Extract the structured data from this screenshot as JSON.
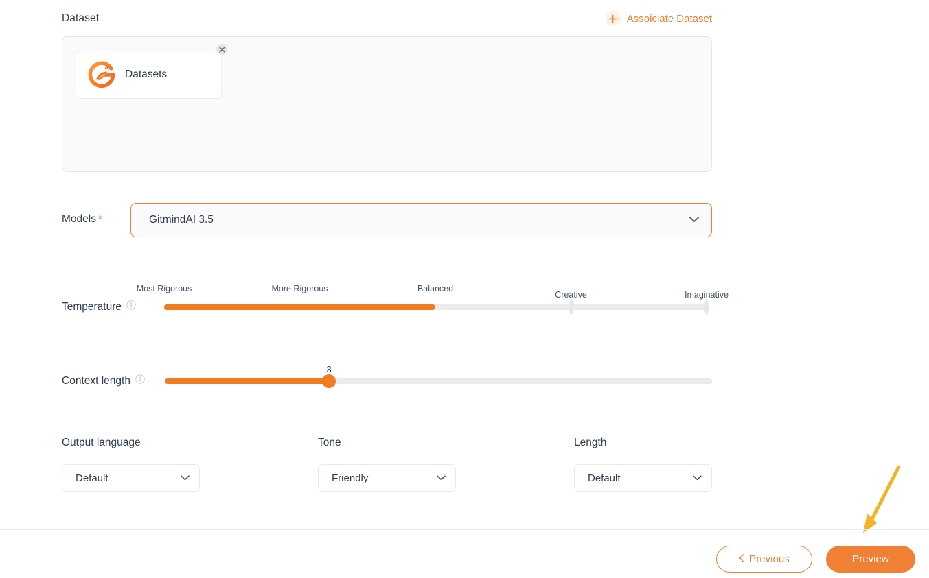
{
  "dataset": {
    "section_label": "Dataset",
    "associate_label": "Assoiciate Dataset",
    "associate_icon": "plus-icon",
    "card": {
      "name": "Datasets",
      "logo_icon": "gitmind-dataset-logo",
      "close_icon": "close-icon"
    }
  },
  "models": {
    "label": "Models",
    "required_mark": "*",
    "value": "GitmindAI 3.5",
    "chevron_icon": "chevron-down-icon"
  },
  "temperature": {
    "label": "Temperature",
    "info_icon": "info-icon",
    "stops": [
      {
        "label": "Most Rigorous",
        "active": true
      },
      {
        "label": "More Rigorous",
        "active": true
      },
      {
        "label": "Balanced",
        "active": true
      },
      {
        "label": "Creative",
        "active": false
      },
      {
        "label": "Imaginative",
        "active": false
      }
    ],
    "selected_index": 2,
    "selected_label": "Balanced"
  },
  "context_length": {
    "label": "Context length",
    "info_icon": "info-icon",
    "value": "3",
    "min": 0,
    "max": 10,
    "fill_percent": 30
  },
  "selects": [
    {
      "label": "Output language",
      "value": "Default",
      "chevron_icon": "chevron-down-icon"
    },
    {
      "label": "Tone",
      "value": "Friendly",
      "chevron_icon": "chevron-down-icon"
    },
    {
      "label": "Length",
      "value": "Default",
      "chevron_icon": "chevron-down-icon"
    }
  ],
  "footer": {
    "previous_label": "Previous",
    "previous_icon": "chevron-left-icon",
    "preview_label": "Preview"
  },
  "annotation": {
    "arrow_icon": "arrow-down-left-icon",
    "color": "#f5b324"
  },
  "colors": {
    "accent": "#f08033",
    "slider": "#ef7d22",
    "required": "#f1576f",
    "track": "#ebebef",
    "panel_bg": "#fafafa",
    "text": "#2e3d4f"
  }
}
